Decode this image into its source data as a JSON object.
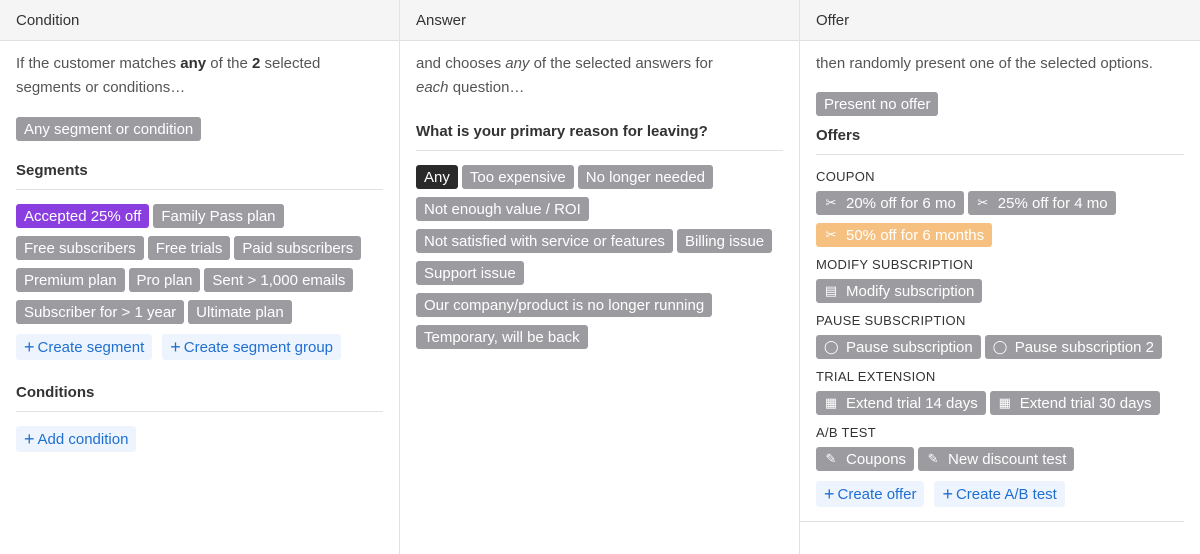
{
  "condition": {
    "header": "Condition",
    "desc_pre": "If the customer matches ",
    "desc_any": "any",
    "desc_mid": " of the ",
    "desc_count": "2",
    "desc_post": " selected segments or conditions…",
    "any_tag": "Any segment or condition",
    "segments_title": "Segments",
    "segments": [
      "Accepted 25% off",
      "Family Pass plan",
      "Free subscribers",
      "Free trials",
      "Paid subscribers",
      "Premium plan",
      "Pro plan",
      "Sent > 1,000 emails",
      "Subscriber for > 1 year",
      "Ultimate plan"
    ],
    "create_segment": "Create segment",
    "create_segment_group": "Create segment group",
    "conditions_title": "Conditions",
    "add_condition": "Add condition"
  },
  "answer": {
    "header": "Answer",
    "desc_pre": "and chooses ",
    "desc_any": "any",
    "desc_mid": " of the selected answers for ",
    "desc_each": "each",
    "desc_post": " question…",
    "question": "What is your primary reason for leaving?",
    "answers": [
      "Any",
      "Too expensive",
      "No longer needed",
      "Not enough value / ROI",
      "Not satisfied with service or features",
      "Billing issue",
      "Support issue",
      "Our company/product is no longer running",
      "Temporary, will be back"
    ]
  },
  "offer": {
    "header": "Offer",
    "desc": "then randomly present one of the selected options.",
    "no_offer": "Present no offer",
    "offers_title": "Offers",
    "coupon_label": "COUPON",
    "coupons": [
      "20% off for 6 mo",
      "25% off for 4 mo",
      "50% off for 6 months"
    ],
    "modify_label": "MODIFY SUBSCRIPTION",
    "modify": "Modify subscription",
    "pause_label": "PAUSE SUBSCRIPTION",
    "pauses": [
      "Pause subscription",
      "Pause subscription 2"
    ],
    "trial_label": "TRIAL EXTENSION",
    "trials": [
      "Extend trial 14 days",
      "Extend trial 30 days"
    ],
    "ab_label": "A/B TEST",
    "ab_tests": [
      "Coupons",
      "New discount test"
    ],
    "create_offer": "Create offer",
    "create_ab": "Create A/B test"
  },
  "colors": {
    "tag_gray": "#9b9ba0",
    "tag_selected_purple": "#8a3ee0",
    "tag_selected_dark": "#2a2a2a",
    "tag_selected_orange": "#f5c080",
    "link_blue": "#1f6fd1"
  },
  "icons": {
    "coupon": "scissors-icon",
    "modify": "document-icon",
    "pause": "pause-circle-icon",
    "trial": "calendar-icon",
    "ab": "pencil-icon",
    "add": "plus-icon"
  }
}
